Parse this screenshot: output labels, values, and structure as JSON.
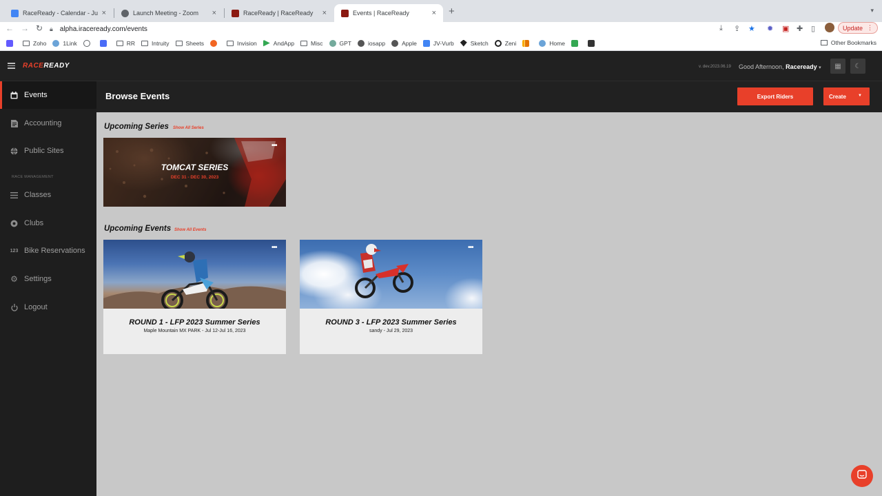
{
  "browser": {
    "tabs": [
      {
        "title": "RaceReady - Calendar - June",
        "active": false
      },
      {
        "title": "Launch Meeting - Zoom",
        "active": false
      },
      {
        "title": "RaceReady | RaceReady",
        "active": false
      },
      {
        "title": "Events | RaceReady",
        "active": true
      }
    ],
    "url": "alpha.iraceready.com/events",
    "update_label": "Update",
    "bookmarks": [
      "Zoho",
      "1Link",
      "RR",
      "Intruity",
      "Sheets",
      "Invision",
      "AndApp",
      "Misc",
      "GPT",
      "iosapp",
      "Apple",
      "JV-Vurb",
      "Sketch",
      "Zeni",
      "Home"
    ],
    "other_bookmarks": "Other Bookmarks"
  },
  "header": {
    "logo_race": "RACE",
    "logo_ready": "READY",
    "version": "v. dev.2023.06.19",
    "greeting": "Good Afternoon,",
    "user": "Raceready"
  },
  "sidebar": {
    "items": [
      {
        "label": "Events"
      },
      {
        "label": "Accounting"
      },
      {
        "label": "Public Sites"
      },
      {
        "label": "Classes"
      },
      {
        "label": "Clubs"
      },
      {
        "label": "Bike Reservations"
      },
      {
        "label": "Settings"
      },
      {
        "label": "Logout"
      }
    ],
    "section_label": "RACE MANAGEMENT"
  },
  "page": {
    "title": "Browse Events",
    "export_label": "Export Riders",
    "create_label": "Create"
  },
  "series_section": {
    "title": "Upcoming Series",
    "show_all": "Show All Series",
    "cards": [
      {
        "name": "TOMCAT SERIES",
        "dates": "DEC 31 - DEC 30, 2023"
      }
    ]
  },
  "events_section": {
    "title": "Upcoming Events",
    "show_all": "Show All Events",
    "cards": [
      {
        "name": "ROUND 1 - LFP 2023 Summer Series",
        "sub": "Maple Mountain MX PARK - Jul 12-Jul 16, 2023"
      },
      {
        "name": "ROUND 3 - LFP 2023 Summer Series",
        "sub": "sandy - Jul 29, 2023"
      }
    ]
  },
  "colors": {
    "accent": "#e8402a",
    "sidebar_bg": "#1e1e1e",
    "header_bg": "#212121",
    "content_bg": "#c8c8c8"
  },
  "icons": {
    "menu": "hamburger-icon",
    "events": "calendar-icon",
    "accounting": "document-icon",
    "public_sites": "globe-icon",
    "classes": "list-icon",
    "clubs": "club-icon",
    "bike_reservations": "numbers-icon",
    "settings": "gear-icon",
    "logout": "power-icon",
    "chat": "chat-icon"
  }
}
